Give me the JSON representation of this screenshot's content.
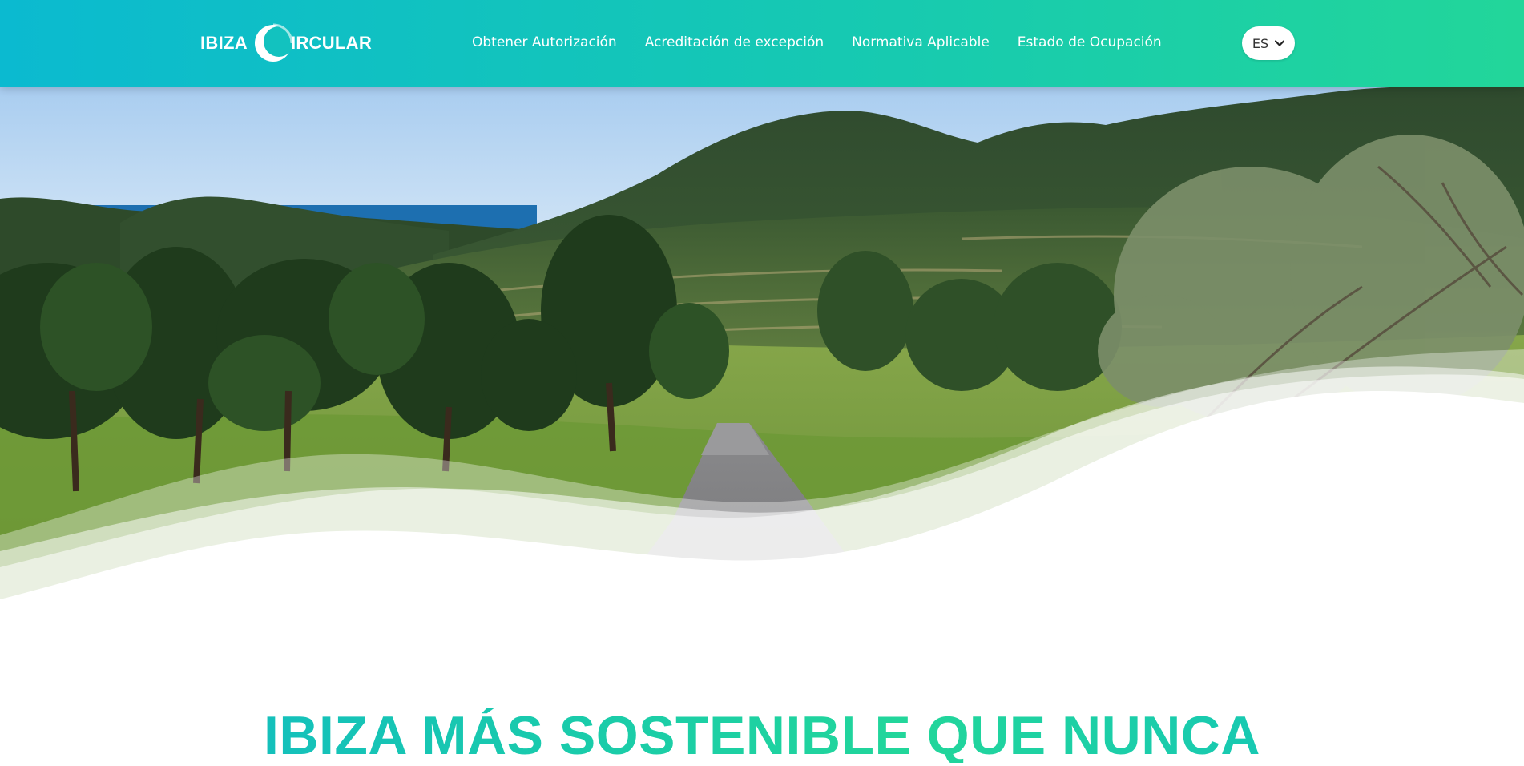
{
  "header": {
    "logo": {
      "word_left": "IBIZA",
      "word_right": "IRCULAR"
    },
    "nav": [
      {
        "label": "Obtener Autorización"
      },
      {
        "label": "Acreditación de excepción"
      },
      {
        "label": "Normativa Aplicable"
      },
      {
        "label": "Estado de Ocupación"
      }
    ],
    "language": {
      "selected": "ES",
      "icon": "chevron-down-icon"
    }
  },
  "hero": {
    "image": "hillside-road-landscape-photo"
  },
  "headline": "IBIZA MÁS SOSTENIBLE QUE NUNCA",
  "colors": {
    "header_start": "#0bbad0",
    "header_end": "#22d69a",
    "headline_teal": "#0fb7c9",
    "headline_green": "#22d69a"
  }
}
